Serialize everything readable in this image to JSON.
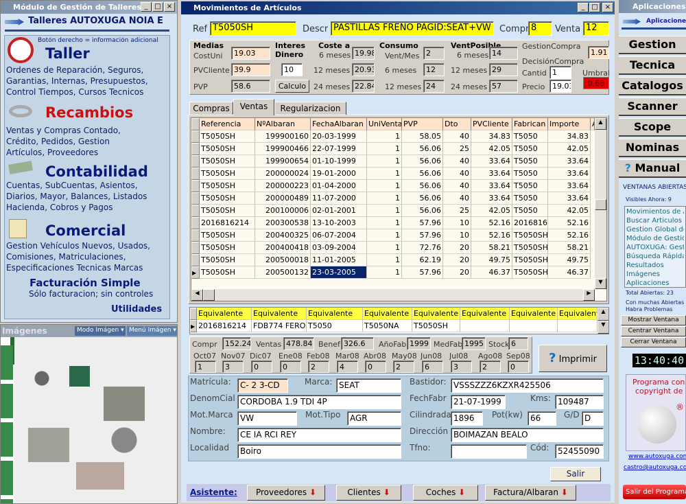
{
  "left": {
    "title": "Módulo de Gestión de Talleres",
    "header": "Talleres AUTOXUGA NOIA E",
    "hint": "Botón derecho = información adicional",
    "sections": [
      {
        "title": "Taller",
        "lines": [
          "Ordenes de Reparación, Seguros,",
          "Garantias, Internas, Presupuestos,",
          "Control Tiempos, Cursos Tecnicos"
        ]
      },
      {
        "title": "Recambios",
        "lines": [
          "Ventas y Compras Contado,",
          "Crédito, Pedidos,  Gestion",
          "Artículos, Proveedores"
        ]
      },
      {
        "title": "Contabilidad",
        "lines": [
          "Cuentas, SubCuentas, Asientos,",
          "Diarios, Mayor, Balances, Listados",
          "Hacienda, Cobros y Pagos"
        ]
      },
      {
        "title": "Comercial",
        "lines": [
          "Gestion Vehículos Nuevos, Usados,",
          "Comisiones, Matriculaciones,",
          "Especificaciones Tecnicas Marcas"
        ]
      }
    ],
    "fact_title": "Facturación Simple",
    "fact_sub": "Sólo facturacion; sin controles",
    "utilidades": "Utilidades",
    "images_title": "Imágenes",
    "modo": "Modo Imágen",
    "menu": "Menú Imágen"
  },
  "main": {
    "title": "Movimientos de Artículos",
    "ref_label": "Ref",
    "ref": "T5050SH",
    "descr_label": "Descr",
    "descr": "PASTILLAS FRENO PAGID:SEAT+VW",
    "compr_label": "Compr",
    "compr": "8",
    "venta_label": "Venta",
    "venta": "12",
    "medias": "Medias",
    "costuni_label": "CostUni",
    "costuni": "19.03",
    "pvcliente_label": "PVCliente",
    "pvcliente": "39.9",
    "pvp_label": "PVP",
    "pvp": "58.6",
    "interes1": "Interes",
    "interes2": "Dinero",
    "interes": "10",
    "calculo": "Calculo",
    "coste_label": "Coste a",
    "coste": [
      {
        "l": "6 meses",
        "v": "19.98"
      },
      {
        "l": "12 meses",
        "v": "20.93"
      },
      {
        "l": "24 meses",
        "v": "22.84"
      }
    ],
    "consumo_label": "Consumo",
    "consumo": [
      {
        "l": "Vent/Mes",
        "v": "2"
      },
      {
        "l": "6 meses",
        "v": "12"
      },
      {
        "l": "12 meses",
        "v": "24"
      }
    ],
    "ventposible_label": "VentPosible",
    "ventposible": [
      {
        "l": "6 meses",
        "v": "14"
      },
      {
        "l": "12 meses",
        "v": "29"
      },
      {
        "l": "24 meses",
        "v": "57"
      }
    ],
    "gestion_label": "GestionCompra",
    "gestion": "1.91",
    "decision_label": "DecisiónCompra",
    "cantid_label": "Cantid",
    "cantid": "1",
    "precio_label": "Precio",
    "precio": "19.03",
    "umbral_label": "Umbral",
    "umbral": "0.68",
    "tabs": [
      "Compras",
      "Ventas",
      "Regularizacion"
    ],
    "active_tab": "Ventas",
    "table": {
      "columns": [
        "Referencia",
        "NºAlbaran",
        "FechaAlbaran",
        "UniVenta",
        "PVP",
        "Dto",
        "PVCliente",
        "Fabrican",
        "Importe",
        "A"
      ],
      "rows": [
        [
          "T5050SH",
          "199900160",
          "20-03-1999",
          "1",
          "58.05",
          "40",
          "34.83",
          "T5050",
          "34.83"
        ],
        [
          "T5050SH",
          "199900466",
          "22-07-1999",
          "1",
          "56.06",
          "25",
          "42.05",
          "T5050",
          "42.05"
        ],
        [
          "T5050SH",
          "199900654",
          "01-10-1999",
          "1",
          "56.06",
          "40",
          "33.64",
          "T5050",
          "33.64"
        ],
        [
          "T5050SH",
          "200000024",
          "19-01-2000",
          "1",
          "56.06",
          "40",
          "33.64",
          "T5050",
          "33.64"
        ],
        [
          "T5050SH",
          "200000223",
          "01-04-2000",
          "1",
          "56.06",
          "40",
          "33.64",
          "T5050",
          "33.64"
        ],
        [
          "T5050SH",
          "200000489",
          "11-07-2000",
          "1",
          "56.06",
          "40",
          "33.64",
          "T5050",
          "33.64"
        ],
        [
          "T5050SH",
          "200100006",
          "02-01-2001",
          "1",
          "56.06",
          "25",
          "42.05",
          "T5050",
          "42.05"
        ],
        [
          "2016816214",
          "200300538",
          "13-10-2003",
          "1",
          "57.96",
          "10",
          "52.16",
          "2016816",
          "52.16"
        ],
        [
          "T5050SH",
          "200400325",
          "06-07-2004",
          "1",
          "57.96",
          "10",
          "52.16",
          "T5050SH",
          "52.16"
        ],
        [
          "T5050SH",
          "200400418",
          "03-09-2004",
          "1",
          "72.76",
          "20",
          "58.21",
          "T5050SH",
          "58.21"
        ],
        [
          "T5050SH",
          "200500018",
          "11-01-2005",
          "1",
          "62.19",
          "20",
          "49.75",
          "T5050SH",
          "49.75"
        ],
        [
          "T5050SH",
          "200500132",
          "23-03-2005",
          "1",
          "57.96",
          "20",
          "46.37",
          "T5050SH",
          "46.37"
        ]
      ],
      "selected_row": 11
    },
    "equiv": {
      "header": "Equivalente",
      "values": [
        "2016816214",
        "FDB774 FERO",
        "T5050",
        "T5050NA",
        "T5050SH",
        "",
        "",
        ""
      ]
    },
    "stats": [
      {
        "l": "Compr",
        "v": "152.24"
      },
      {
        "l": "Ventas",
        "v": "478.84"
      },
      {
        "l": "Benef",
        "v": "326.6"
      },
      {
        "l": "AñoFab",
        "v": "1999"
      },
      {
        "l": "MedFab",
        "v": "1995"
      },
      {
        "l": "Stock",
        "v": "6"
      }
    ],
    "months": [
      {
        "l": "Oct07",
        "v": "1"
      },
      {
        "l": "Nov07",
        "v": "3"
      },
      {
        "l": "Dic07",
        "v": "0"
      },
      {
        "l": "Ene08",
        "v": "0"
      },
      {
        "l": "Feb08",
        "v": "2"
      },
      {
        "l": "Mar08",
        "v": "4"
      },
      {
        "l": "Abr08",
        "v": "0"
      },
      {
        "l": "May08",
        "v": "2"
      },
      {
        "l": "Jun08",
        "v": "6"
      },
      {
        "l": "Jul08",
        "v": "3"
      },
      {
        "l": "Ago08",
        "v": "2"
      },
      {
        "l": "Sep08",
        "v": "0"
      }
    ],
    "imprimir": "Imprimir",
    "vehicle": {
      "matricula_l": "Matrícula:",
      "matricula": "C-  2  3-CD",
      "marca_l": "Marca:",
      "marca": "SEAT",
      "denom_l": "DenomCial",
      "denom": "CORDOBA 1.9 TDI 4P",
      "motmarca_l": "Mot.Marca",
      "motmarca": "VW",
      "mottipo_l": "Mot.Tipo",
      "mottipo": "AGR",
      "nombre_l": "Nombre:",
      "nombre": "CE  IA     RCI   REY",
      "localidad_l": "Localidad",
      "localidad": "Boiro",
      "bastidor_l": "Bastidor:",
      "bastidor": "VSSSZZZ6KZXR425506",
      "fechfabr_l": "FechFabr",
      "fechfabr": "21-07-1999",
      "kms_l": "Kms:",
      "kms": "109487",
      "cil_l": "Cilindrada",
      "cil": "1896",
      "pot_l": "Pot(kw)",
      "pot": "66",
      "gd_l": "G/D",
      "gd": "D",
      "dir_l": "Dirección",
      "dir": "BOIMAZAN      BEALO",
      "tfno_l": "Tfno:",
      "tfno": "",
      "cod_l": "Cód:",
      "cod": "52455090"
    },
    "salir": "Salir",
    "asistente": "Asistente:",
    "asist_buttons": [
      "Proveedores",
      "Clientes",
      "Coches",
      "Factura/Albaran"
    ]
  },
  "right": {
    "title": "Aplicaciones",
    "header": "Aplicaciones",
    "buttons": [
      "Gestion",
      "Tecnica",
      "Catalogos",
      "Scanner",
      "Scope",
      "Nominas",
      "Manual"
    ],
    "ventanas": "VENTANAS ABIERTAS",
    "visibles": "Visibles Ahora: 9",
    "windows": [
      "Movimientos de Artículos",
      "Buscar Articulos",
      "Gestion Global de",
      "Módulo de Gestión",
      "AUTOXUGA:  Gestión",
      "Búsqueda Rápida",
      "Resultados",
      "Imágenes",
      "Aplicaciones"
    ],
    "total": "Total Abiertas: 23",
    "warn1": "Con muchas Abiertas",
    "warn2": "Habra Problemas",
    "mostrar": "Mostrar Ventana",
    "centrar": "Centrar Ventana",
    "cerrar": "Cerrar Ventana",
    "clock": "13:40:40",
    "copyright1": "Programa con",
    "copyright2": "copyright de",
    "web": "www.autoxuga.com",
    "email": "castro@autoxuga.com",
    "salir": "Salir del Programa"
  },
  "colors": {
    "title_active": "#0a246a",
    "yellow_field": "#ffff00",
    "peach_field": "#fde2cc",
    "umbral_red": "#e00000",
    "link": "#0000cc"
  }
}
